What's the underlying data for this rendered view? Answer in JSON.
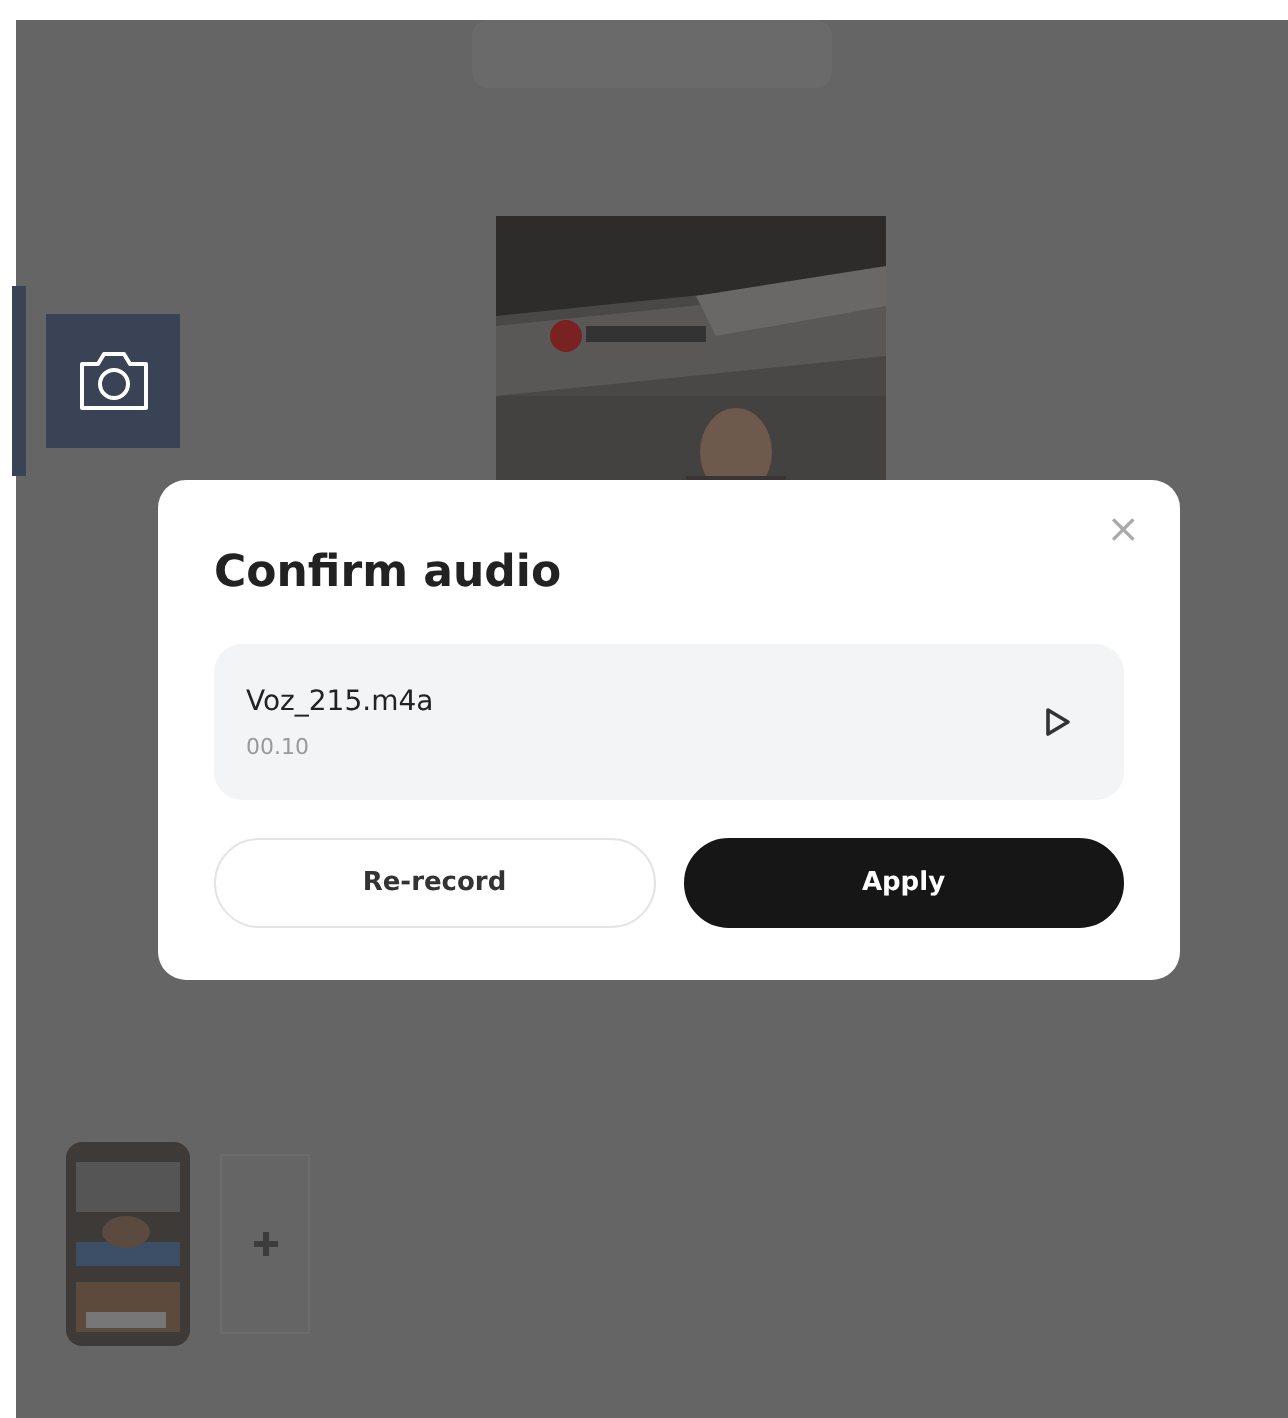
{
  "dialog": {
    "title": "Confirm audio",
    "close": "×",
    "audio": {
      "file_name": "Voz_215.m4a",
      "duration": "00.10"
    },
    "buttons": [
      {
        "label": "Re-record",
        "kind": "secondary"
      },
      {
        "label": "Apply",
        "kind": "primary"
      }
    ]
  }
}
